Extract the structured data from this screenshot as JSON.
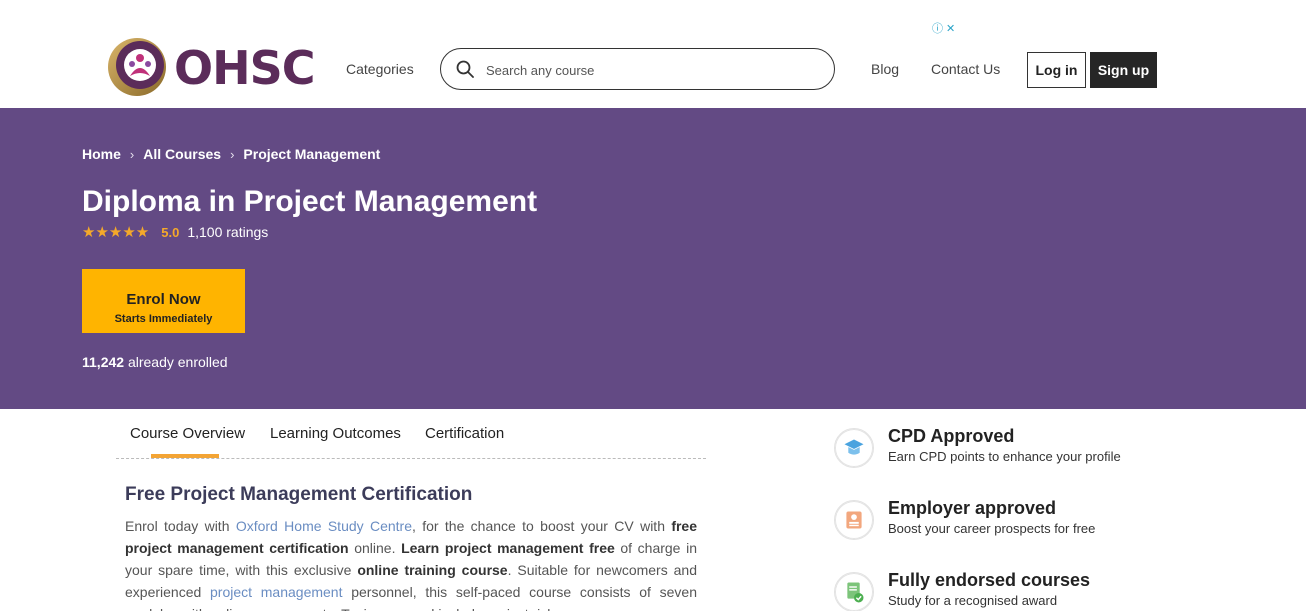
{
  "header": {
    "logo_text": "OHSC",
    "nav": {
      "categories": "Categories",
      "blog": "Blog",
      "contact": "Contact Us"
    },
    "search": {
      "placeholder": "Search any course"
    },
    "login_label": "Log in",
    "signup_label": "Sign up",
    "ad_choices": "ⓘ ✕"
  },
  "hero": {
    "breadcrumb": [
      "Home",
      "All Courses",
      "Project Management"
    ],
    "title": "Diploma in Project Management",
    "rating": {
      "stars": "★★★★★",
      "value": "5.0",
      "count": "1,100 ratings"
    },
    "enrol": {
      "label": "Enrol Now",
      "sublabel": "Starts Immediately"
    },
    "enrolled_count": "11,242",
    "enrolled_text": " already enrolled",
    "background_color": "#634a84",
    "accent_color": "#ffb400"
  },
  "tabs": [
    "Course Overview",
    "Learning Outcomes",
    "Certification"
  ],
  "active_tab": "Course Overview",
  "content": {
    "heading": "Free Project Management Certification",
    "p1": "Enrol today with ",
    "link1": "Oxford Home Study Centre",
    "p2": ", for the chance to boost your CV with ",
    "b1": "free project management certification",
    "p3": " online.  ",
    "b2": "Learn project management free",
    "p4": " of charge in your spare time, with this exclusive ",
    "b3": "online training course",
    "p5": ".  Suitable for newcomers and experienced ",
    "link2": "project management",
    "p6": " personnel, this self-paced course consists of seven modules with online assessments.  Topics covered include project risk"
  },
  "features": [
    {
      "title": "CPD Approved",
      "subtitle": "Earn CPD points to enhance your profile",
      "icon": "graduation-cap-icon"
    },
    {
      "title": "Employer approved",
      "subtitle": "Boost your career prospects for free",
      "icon": "certificate-icon"
    },
    {
      "title": "Fully endorsed courses",
      "subtitle": "Study for a recognised award",
      "icon": "document-check-icon"
    }
  ]
}
